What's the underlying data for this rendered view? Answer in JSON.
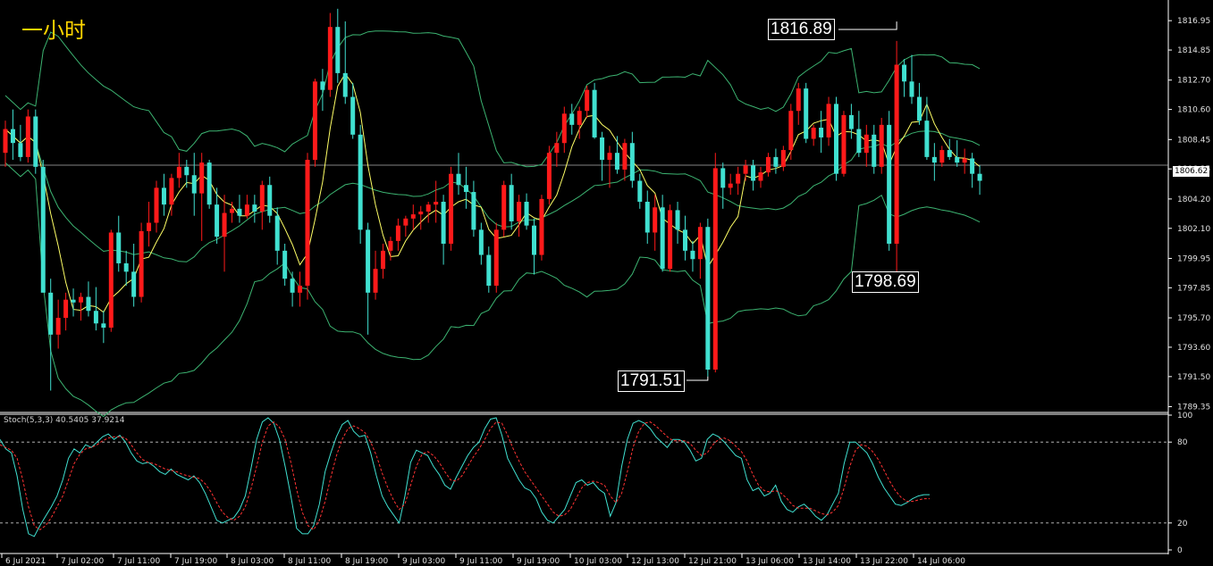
{
  "title": "一小时",
  "current_price": "1806.62",
  "colors": {
    "background": "#000000",
    "bull": "#ff1a1a",
    "bear": "#40e0d0",
    "bollinger": "#3cb371",
    "ma": "#ffff66",
    "stoch_main": "#40e0d0",
    "stoch_signal": "#ff3333",
    "axis": "#ffffff"
  },
  "callouts": {
    "high": "1816.89",
    "low": "1791.51",
    "mid_low": "1798.69"
  },
  "chart_data": [
    {
      "type": "candlestick",
      "title": "",
      "y_ticks": [
        "1816.95",
        "1814.85",
        "1812.70",
        "1810.60",
        "1808.45",
        "1806.35",
        "1804.20",
        "1802.10",
        "1799.95",
        "1797.85",
        "1795.70",
        "1793.60",
        "1791.50",
        "1789.35"
      ],
      "x_ticks": [
        "6 Jul 2021",
        "7 Jul 02:00",
        "7 Jul 11:00",
        "7 Jul 19:00",
        "8 Jul 03:00",
        "8 Jul 11:00",
        "8 Jul 19:00",
        "9 Jul 03:00",
        "9 Jul 11:00",
        "9 Jul 19:00",
        "10 Jul 03:00",
        "12 Jul 13:00",
        "12 Jul 21:00",
        "13 Jul 06:00",
        "13 Jul 14:00",
        "13 Jul 22:00",
        "14 Jul 06:00"
      ],
      "ylim": [
        1789.0,
        1818.3
      ],
      "current": 1806.62,
      "candles": [
        [
          1807.5,
          1809.8,
          1806.5,
          1809.2
        ],
        [
          1809.2,
          1810.6,
          1807.0,
          1808.2
        ],
        [
          1808.2,
          1809.5,
          1806.9,
          1807.2
        ],
        [
          1807.2,
          1810.6,
          1806.8,
          1810.1
        ],
        [
          1810.1,
          1810.6,
          1806.0,
          1806.5
        ],
        [
          1806.5,
          1807.0,
          1799.0,
          1797.5
        ],
        [
          1797.5,
          1798.5,
          1790.5,
          1794.5
        ],
        [
          1794.5,
          1797.0,
          1793.5,
          1795.7
        ],
        [
          1795.7,
          1797.5,
          1794.8,
          1797.0
        ],
        [
          1797.0,
          1797.8,
          1795.8,
          1796.8
        ],
        [
          1796.8,
          1797.5,
          1795.5,
          1797.2
        ],
        [
          1797.2,
          1798.3,
          1795.8,
          1796.2
        ],
        [
          1796.2,
          1797.9,
          1794.8,
          1795.3
        ],
        [
          1795.3,
          1796.2,
          1793.9,
          1795.0
        ],
        [
          1795.0,
          1802.0,
          1794.7,
          1801.8
        ],
        [
          1801.8,
          1803.0,
          1799.0,
          1799.6
        ],
        [
          1799.6,
          1800.5,
          1798.0,
          1799.0
        ],
        [
          1799.0,
          1801.0,
          1796.5,
          1797.2
        ],
        [
          1797.2,
          1802.5,
          1796.8,
          1801.9
        ],
        [
          1801.9,
          1804.0,
          1800.8,
          1802.5
        ],
        [
          1802.5,
          1805.5,
          1801.8,
          1805.0
        ],
        [
          1805.0,
          1806.0,
          1803.0,
          1803.8
        ],
        [
          1803.8,
          1806.0,
          1803.0,
          1805.7
        ],
        [
          1805.7,
          1807.5,
          1805.0,
          1806.5
        ],
        [
          1806.5,
          1807.0,
          1805.0,
          1805.9
        ],
        [
          1805.9,
          1807.5,
          1803.0,
          1804.6
        ],
        [
          1804.6,
          1807.5,
          1801.2,
          1806.8
        ],
        [
          1806.8,
          1807.0,
          1803.5,
          1803.8
        ],
        [
          1803.8,
          1805.0,
          1801.0,
          1801.5
        ],
        [
          1801.5,
          1804.5,
          1799.0,
          1803.2
        ],
        [
          1803.2,
          1804.0,
          1802.5,
          1803.5
        ],
        [
          1803.5,
          1804.5,
          1802.5,
          1803.0
        ],
        [
          1803.0,
          1804.5,
          1802.8,
          1803.8
        ],
        [
          1803.8,
          1804.5,
          1802.5,
          1803.3
        ],
        [
          1803.3,
          1805.5,
          1802.0,
          1805.2
        ],
        [
          1805.2,
          1805.8,
          1802.5,
          1803.0
        ],
        [
          1803.0,
          1803.6,
          1799.5,
          1800.5
        ],
        [
          1800.5,
          1801.0,
          1798.0,
          1798.5
        ],
        [
          1798.5,
          1799.0,
          1796.5,
          1797.5
        ],
        [
          1797.5,
          1799.0,
          1796.5,
          1798.0
        ],
        [
          1798.0,
          1807.5,
          1797.0,
          1807.0
        ],
        [
          1807.0,
          1812.8,
          1806.5,
          1812.6
        ],
        [
          1812.6,
          1813.5,
          1810.5,
          1812.0
        ],
        [
          1812.0,
          1817.5,
          1811.5,
          1816.5
        ],
        [
          1816.5,
          1817.8,
          1812.5,
          1813.2
        ],
        [
          1813.2,
          1816.9,
          1811.0,
          1811.5
        ],
        [
          1811.5,
          1812.5,
          1808.5,
          1808.8
        ],
        [
          1808.8,
          1809.5,
          1801.0,
          1802.0
        ],
        [
          1802.0,
          1802.5,
          1794.5,
          1797.5
        ],
        [
          1797.5,
          1800.5,
          1797.0,
          1799.2
        ],
        [
          1799.2,
          1801.0,
          1798.5,
          1800.5
        ],
        [
          1800.5,
          1801.5,
          1799.8,
          1801.2
        ],
        [
          1801.2,
          1802.8,
          1800.5,
          1802.3
        ],
        [
          1802.3,
          1803.0,
          1801.5,
          1802.8
        ],
        [
          1802.8,
          1803.8,
          1802.0,
          1803.1
        ],
        [
          1803.1,
          1803.7,
          1802.0,
          1803.3
        ],
        [
          1803.3,
          1804.0,
          1802.5,
          1803.8
        ],
        [
          1803.8,
          1805.5,
          1802.5,
          1804.0
        ],
        [
          1804.0,
          1804.5,
          1799.5,
          1801.0
        ],
        [
          1801.0,
          1806.5,
          1800.5,
          1806.0
        ],
        [
          1806.0,
          1807.5,
          1804.5,
          1805.2
        ],
        [
          1805.2,
          1806.5,
          1803.5,
          1804.7
        ],
        [
          1804.7,
          1805.5,
          1801.5,
          1802.0
        ],
        [
          1802.0,
          1802.5,
          1799.5,
          1800.2
        ],
        [
          1800.2,
          1800.8,
          1797.5,
          1798.0
        ],
        [
          1798.0,
          1802.5,
          1797.5,
          1802.0
        ],
        [
          1802.0,
          1805.5,
          1801.5,
          1805.2
        ],
        [
          1805.2,
          1806.0,
          1802.0,
          1802.6
        ],
        [
          1802.6,
          1804.5,
          1801.5,
          1804.0
        ],
        [
          1804.0,
          1804.6,
          1802.0,
          1802.3
        ],
        [
          1802.3,
          1802.8,
          1798.8,
          1800.2
        ],
        [
          1800.2,
          1804.5,
          1799.8,
          1804.2
        ],
        [
          1804.2,
          1808.0,
          1803.8,
          1807.5
        ],
        [
          1807.5,
          1809.0,
          1806.5,
          1808.2
        ],
        [
          1808.2,
          1810.8,
          1807.5,
          1810.3
        ],
        [
          1810.3,
          1811.0,
          1808.8,
          1809.5
        ],
        [
          1809.5,
          1810.8,
          1808.5,
          1810.5
        ],
        [
          1810.5,
          1812.3,
          1810.0,
          1812.0
        ],
        [
          1812.0,
          1812.5,
          1808.5,
          1808.6
        ],
        [
          1808.6,
          1809.0,
          1805.5,
          1807.0
        ],
        [
          1807.0,
          1808.0,
          1805.0,
          1807.5
        ],
        [
          1807.5,
          1808.7,
          1806.0,
          1806.3
        ],
        [
          1806.3,
          1808.5,
          1805.5,
          1808.2
        ],
        [
          1808.2,
          1809.0,
          1805.0,
          1805.5
        ],
        [
          1805.5,
          1806.0,
          1803.5,
          1804.0
        ],
        [
          1804.0,
          1804.8,
          1801.0,
          1801.8
        ],
        [
          1801.8,
          1804.5,
          1800.5,
          1803.6
        ],
        [
          1803.6,
          1804.5,
          1799.0,
          1799.2
        ],
        [
          1799.2,
          1803.8,
          1799.0,
          1803.4
        ],
        [
          1803.4,
          1804.0,
          1801.0,
          1802.0
        ],
        [
          1802.0,
          1803.0,
          1799.8,
          1800.5
        ],
        [
          1800.5,
          1801.2,
          1799.0,
          1799.9
        ],
        [
          1799.9,
          1802.5,
          1798.5,
          1802.2
        ],
        [
          1802.2,
          1802.8,
          1791.51,
          1792.0
        ],
        [
          1792.0,
          1807.5,
          1791.8,
          1806.4
        ],
        [
          1806.4,
          1806.8,
          1803.5,
          1805.0
        ],
        [
          1805.0,
          1806.0,
          1804.5,
          1805.3
        ],
        [
          1805.3,
          1806.5,
          1804.5,
          1806.0
        ],
        [
          1806.0,
          1807.0,
          1805.5,
          1806.6
        ],
        [
          1806.6,
          1807.0,
          1804.8,
          1805.5
        ],
        [
          1805.5,
          1806.5,
          1805.0,
          1806.1
        ],
        [
          1806.1,
          1807.5,
          1805.8,
          1807.2
        ],
        [
          1807.2,
          1807.8,
          1806.0,
          1806.5
        ],
        [
          1806.5,
          1808.0,
          1806.2,
          1807.7
        ],
        [
          1807.7,
          1811.0,
          1807.0,
          1810.5
        ],
        [
          1810.5,
          1812.5,
          1809.5,
          1812.1
        ],
        [
          1812.1,
          1812.5,
          1808.2,
          1808.5
        ],
        [
          1808.5,
          1809.5,
          1808.0,
          1809.3
        ],
        [
          1809.3,
          1810.5,
          1807.5,
          1808.6
        ],
        [
          1808.6,
          1811.5,
          1808.0,
          1811.0
        ],
        [
          1811.0,
          1811.5,
          1805.5,
          1806.0
        ],
        [
          1806.0,
          1810.5,
          1805.8,
          1810.2
        ],
        [
          1810.2,
          1811.0,
          1808.5,
          1809.2
        ],
        [
          1809.2,
          1810.5,
          1807.2,
          1807.5
        ],
        [
          1807.5,
          1809.5,
          1806.5,
          1808.8
        ],
        [
          1808.8,
          1809.5,
          1806.0,
          1806.5
        ],
        [
          1806.5,
          1810.0,
          1806.0,
          1809.5
        ],
        [
          1809.5,
          1810.5,
          1800.5,
          1801.0
        ],
        [
          1801.0,
          1815.5,
          1798.69,
          1813.8
        ],
        [
          1813.8,
          1814.2,
          1811.5,
          1812.6
        ],
        [
          1812.6,
          1814.5,
          1811.0,
          1811.5
        ],
        [
          1811.5,
          1812.5,
          1809.5,
          1809.8
        ],
        [
          1809.8,
          1811.5,
          1807.0,
          1807.2
        ],
        [
          1807.2,
          1808.2,
          1805.5,
          1806.8
        ],
        [
          1806.8,
          1808.0,
          1806.5,
          1807.7
        ],
        [
          1807.7,
          1808.5,
          1807.0,
          1807.2
        ],
        [
          1807.2,
          1808.4,
          1806.5,
          1806.8
        ],
        [
          1806.8,
          1807.8,
          1806.0,
          1807.1
        ],
        [
          1807.1,
          1807.5,
          1805.0,
          1806.0
        ],
        [
          1806.0,
          1806.6,
          1804.5,
          1805.5
        ]
      ]
    },
    {
      "type": "line",
      "title": "Stoch(5,3,3) 40.5405 37.9214",
      "name": "Stoch(5,3,3)",
      "main_value": "40.5405",
      "signal_value": "37.9214",
      "y_ticks": [
        "100",
        "80",
        "20",
        "0"
      ],
      "ylim": [
        0,
        100
      ],
      "levels": [
        80,
        20
      ],
      "main": [
        82,
        75,
        72,
        55,
        30,
        12,
        10,
        18,
        25,
        32,
        40,
        52,
        68,
        75,
        72,
        78,
        76,
        80,
        84,
        86,
        82,
        85,
        80,
        72,
        66,
        64,
        65,
        62,
        58,
        56,
        60,
        56,
        54,
        52,
        55,
        50,
        42,
        32,
        22,
        20,
        22,
        24,
        30,
        40,
        60,
        82,
        95,
        98,
        94,
        82,
        62,
        40,
        16,
        12,
        12,
        18,
        34,
        58,
        72,
        84,
        93,
        96,
        88,
        84,
        85,
        72,
        55,
        40,
        32,
        26,
        20,
        40,
        65,
        74,
        72,
        70,
        62,
        56,
        48,
        45,
        54,
        62,
        70,
        76,
        80,
        90,
        97,
        98,
        85,
        68,
        60,
        52,
        46,
        44,
        38,
        28,
        22,
        20,
        25,
        30,
        40,
        50,
        52,
        48,
        50,
        45,
        42,
        25,
        35,
        62,
        82,
        94,
        96,
        94,
        90,
        84,
        80,
        76,
        82,
        82,
        80,
        74,
        66,
        68,
        82,
        86,
        84,
        80,
        75,
        70,
        68,
        52,
        44,
        46,
        40,
        42,
        48,
        36,
        30,
        28,
        32,
        34,
        30,
        25,
        22,
        26,
        34,
        42,
        64,
        80,
        80,
        76,
        72,
        64,
        54,
        46,
        40,
        34,
        33,
        35,
        38,
        40,
        41,
        41
      ],
      "signal": [
        78,
        76,
        74,
        68,
        52,
        32,
        18,
        15,
        18,
        24,
        32,
        40,
        52,
        64,
        71,
        75,
        76,
        78,
        81,
        83,
        84,
        84,
        83,
        78,
        72,
        67,
        65,
        64,
        62,
        60,
        59,
        58,
        56,
        55,
        54,
        53,
        49,
        43,
        35,
        28,
        24,
        22,
        25,
        32,
        45,
        62,
        80,
        92,
        95,
        91,
        82,
        65,
        45,
        28,
        18,
        15,
        22,
        36,
        54,
        70,
        82,
        90,
        92,
        90,
        87,
        80,
        70,
        57,
        46,
        37,
        30,
        34,
        48,
        62,
        71,
        73,
        70,
        65,
        58,
        52,
        51,
        55,
        62,
        69,
        75,
        82,
        90,
        95,
        94,
        85,
        75,
        66,
        58,
        52,
        46,
        40,
        34,
        28,
        25,
        26,
        30,
        38,
        46,
        50,
        51,
        50,
        48,
        40,
        35,
        42,
        58,
        76,
        88,
        94,
        95,
        92,
        88,
        84,
        81,
        81,
        81,
        79,
        74,
        70,
        72,
        78,
        82,
        83,
        81,
        77,
        73,
        66,
        56,
        48,
        44,
        43,
        44,
        42,
        38,
        33,
        31,
        31,
        31,
        29,
        27,
        26,
        28,
        33,
        46,
        62,
        74,
        78,
        77,
        73,
        67,
        59,
        51,
        44,
        39,
        36,
        36,
        37,
        38,
        38
      ]
    }
  ]
}
